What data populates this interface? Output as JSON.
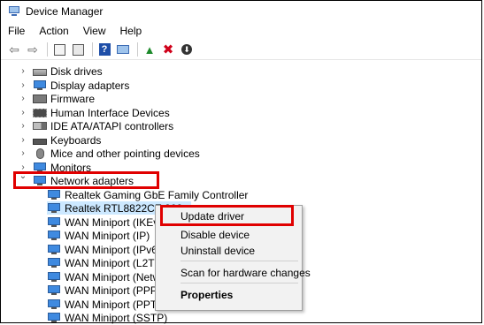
{
  "window": {
    "title": "Device Manager"
  },
  "menu": [
    "File",
    "Action",
    "View",
    "Help"
  ],
  "toolbar": {
    "icons": [
      "back-arrow-icon",
      "forward-arrow-icon",
      "properties-icon",
      "show-hidden-icon",
      "help-icon",
      "monitor-icon",
      "update-driver-icon",
      "uninstall-icon",
      "download-icon"
    ],
    "glyphs": {
      "back": "⇦",
      "forward": "⇨",
      "help": "?",
      "update": "▲",
      "uninstall": "✖",
      "download": "⬇"
    }
  },
  "tree": {
    "categories": [
      {
        "label": "Disk drives",
        "icon": "disk-drive-icon",
        "expanded": false
      },
      {
        "label": "Display adapters",
        "icon": "display-adapter-icon",
        "expanded": false
      },
      {
        "label": "Firmware",
        "icon": "firmware-icon",
        "expanded": false
      },
      {
        "label": "Human Interface Devices",
        "icon": "hid-icon",
        "expanded": false
      },
      {
        "label": "IDE ATA/ATAPI controllers",
        "icon": "ide-controller-icon",
        "expanded": false
      },
      {
        "label": "Keyboards",
        "icon": "keyboard-icon",
        "expanded": false
      },
      {
        "label": "Mice and other pointing devices",
        "icon": "mouse-icon",
        "expanded": false
      },
      {
        "label": "Monitors",
        "icon": "monitor-icon",
        "expanded": false
      },
      {
        "label": "Network adapters",
        "icon": "network-adapter-icon",
        "expanded": true
      }
    ],
    "chevrons": {
      "collapsed": "›",
      "expanded": "⌄"
    },
    "network_adapters": [
      "Realtek Gaming GbE Family Controller",
      "Realtek RTL8822CE 802.",
      "WAN Miniport (IKEv2)",
      "WAN Miniport (IP)",
      "WAN Miniport (IPv6)",
      "WAN Miniport (L2TP)",
      "WAN Miniport (Networ",
      "WAN Miniport (PPPOE)",
      "WAN Miniport (PPTP)",
      "WAN Miniport (SSTP)"
    ],
    "selected_index": 1
  },
  "context_menu": {
    "items": [
      "Update driver",
      "Disable device",
      "Uninstall device",
      "Scan for hardware changes",
      "Properties"
    ]
  },
  "colors": {
    "highlight": "#e00000",
    "selection": "#cce8ff"
  }
}
